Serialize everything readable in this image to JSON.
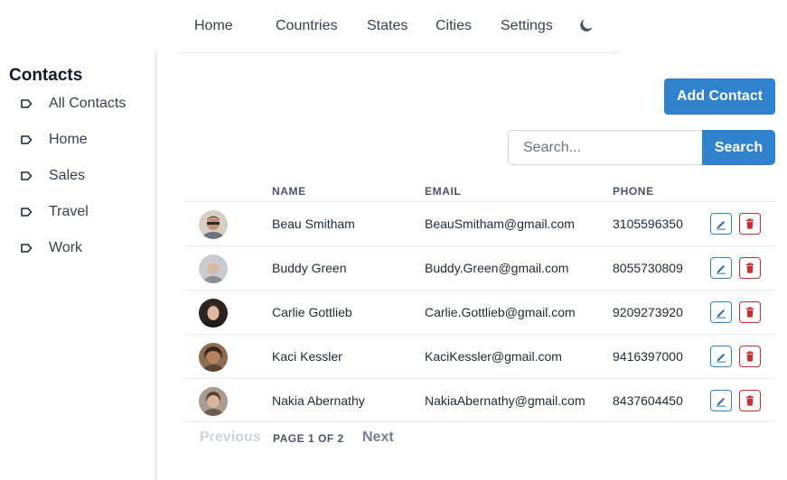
{
  "nav": {
    "items": [
      "Home",
      "Countries",
      "States",
      "Cities",
      "Settings"
    ],
    "theme_icon": "moon-icon"
  },
  "sidebar": {
    "title": "Contacts",
    "items": [
      "All Contacts",
      "Home",
      "Sales",
      "Travel",
      "Work"
    ],
    "item_icon": "tag-icon"
  },
  "actions": {
    "add_label": "Add Contact",
    "search_placeholder": "Search...",
    "search_label": "Search",
    "accent": "#3182ce",
    "danger": "#c53030"
  },
  "table": {
    "headers": [
      "NAME",
      "EMAIL",
      "PHONE"
    ],
    "rows": [
      {
        "name": "Beau Smitham",
        "email": "BeauSmitham@gmail.com",
        "phone": "3105596350"
      },
      {
        "name": "Buddy Green",
        "email": "Buddy.Green@gmail.com",
        "phone": "8055730809"
      },
      {
        "name": "Carlie Gottlieb",
        "email": "Carlie.Gottlieb@gmail.com",
        "phone": "9209273920"
      },
      {
        "name": "Kaci Kessler",
        "email": "KaciKessler@gmail.com",
        "phone": "9416397000"
      },
      {
        "name": "Nakia Abernathy",
        "email": "NakiaAbernathy@gmail.com",
        "phone": "8437604450"
      }
    ]
  },
  "pagination": {
    "prev_label": "Previous",
    "page_word": "PAGE",
    "current": "1",
    "of_word": "OF",
    "total": "2",
    "next_label": "Next"
  }
}
